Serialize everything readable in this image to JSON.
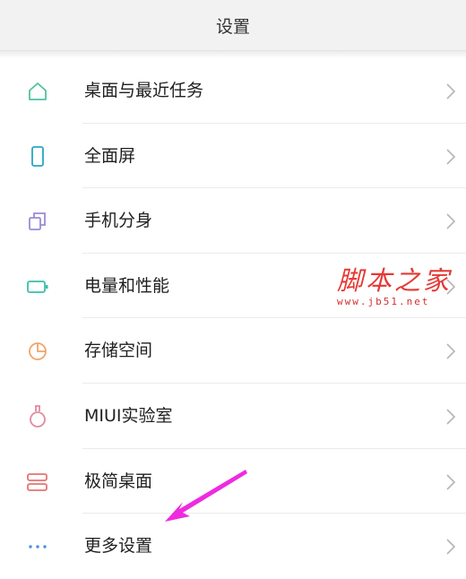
{
  "header": {
    "title": "设置"
  },
  "items": [
    {
      "label": "桌面与最近任务",
      "icon": "home-icon",
      "color": "#4fc3a1"
    },
    {
      "label": "全面屏",
      "icon": "phone-icon",
      "color": "#2aa5c7"
    },
    {
      "label": "手机分身",
      "icon": "clone-icon",
      "color": "#9b8bd6"
    },
    {
      "label": "电量和性能",
      "icon": "battery-icon",
      "color": "#3bbfa8"
    },
    {
      "label": "存储空间",
      "icon": "pie-chart-icon",
      "color": "#f0a46a"
    },
    {
      "label": "MIUI实验室",
      "icon": "flask-icon",
      "color": "#e28aa0"
    },
    {
      "label": "极简桌面",
      "icon": "simple-desktop-icon",
      "color": "#e57373"
    },
    {
      "label": "更多设置",
      "icon": "more-dots-icon",
      "color": "#4a90e2"
    }
  ],
  "watermark": {
    "title": "脚本之家",
    "url": "www.jb51.net",
    "color": "#e53935"
  },
  "annotation": {
    "arrow_color": "#ee2be0"
  }
}
